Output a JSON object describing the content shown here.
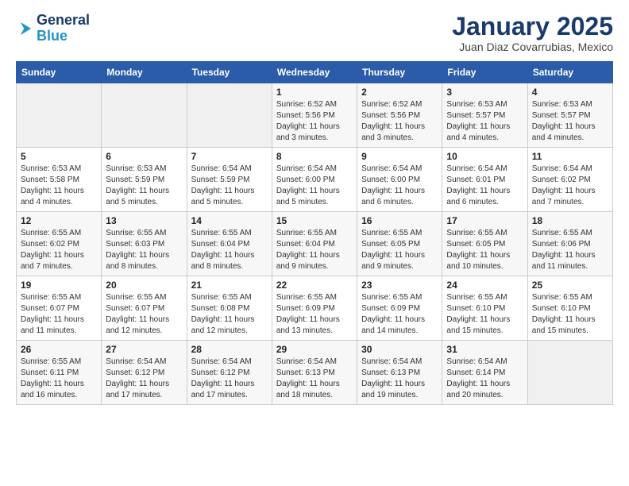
{
  "header": {
    "logo_line1": "General",
    "logo_line2": "Blue",
    "month_title": "January 2025",
    "location": "Juan Diaz Covarrubias, Mexico"
  },
  "weekdays": [
    "Sunday",
    "Monday",
    "Tuesday",
    "Wednesday",
    "Thursday",
    "Friday",
    "Saturday"
  ],
  "weeks": [
    [
      {
        "day": "",
        "info": ""
      },
      {
        "day": "",
        "info": ""
      },
      {
        "day": "",
        "info": ""
      },
      {
        "day": "1",
        "info": "Sunrise: 6:52 AM\nSunset: 5:56 PM\nDaylight: 11 hours and 3 minutes."
      },
      {
        "day": "2",
        "info": "Sunrise: 6:52 AM\nSunset: 5:56 PM\nDaylight: 11 hours and 3 minutes."
      },
      {
        "day": "3",
        "info": "Sunrise: 6:53 AM\nSunset: 5:57 PM\nDaylight: 11 hours and 4 minutes."
      },
      {
        "day": "4",
        "info": "Sunrise: 6:53 AM\nSunset: 5:57 PM\nDaylight: 11 hours and 4 minutes."
      }
    ],
    [
      {
        "day": "5",
        "info": "Sunrise: 6:53 AM\nSunset: 5:58 PM\nDaylight: 11 hours and 4 minutes."
      },
      {
        "day": "6",
        "info": "Sunrise: 6:53 AM\nSunset: 5:59 PM\nDaylight: 11 hours and 5 minutes."
      },
      {
        "day": "7",
        "info": "Sunrise: 6:54 AM\nSunset: 5:59 PM\nDaylight: 11 hours and 5 minutes."
      },
      {
        "day": "8",
        "info": "Sunrise: 6:54 AM\nSunset: 6:00 PM\nDaylight: 11 hours and 5 minutes."
      },
      {
        "day": "9",
        "info": "Sunrise: 6:54 AM\nSunset: 6:00 PM\nDaylight: 11 hours and 6 minutes."
      },
      {
        "day": "10",
        "info": "Sunrise: 6:54 AM\nSunset: 6:01 PM\nDaylight: 11 hours and 6 minutes."
      },
      {
        "day": "11",
        "info": "Sunrise: 6:54 AM\nSunset: 6:02 PM\nDaylight: 11 hours and 7 minutes."
      }
    ],
    [
      {
        "day": "12",
        "info": "Sunrise: 6:55 AM\nSunset: 6:02 PM\nDaylight: 11 hours and 7 minutes."
      },
      {
        "day": "13",
        "info": "Sunrise: 6:55 AM\nSunset: 6:03 PM\nDaylight: 11 hours and 8 minutes."
      },
      {
        "day": "14",
        "info": "Sunrise: 6:55 AM\nSunset: 6:04 PM\nDaylight: 11 hours and 8 minutes."
      },
      {
        "day": "15",
        "info": "Sunrise: 6:55 AM\nSunset: 6:04 PM\nDaylight: 11 hours and 9 minutes."
      },
      {
        "day": "16",
        "info": "Sunrise: 6:55 AM\nSunset: 6:05 PM\nDaylight: 11 hours and 9 minutes."
      },
      {
        "day": "17",
        "info": "Sunrise: 6:55 AM\nSunset: 6:05 PM\nDaylight: 11 hours and 10 minutes."
      },
      {
        "day": "18",
        "info": "Sunrise: 6:55 AM\nSunset: 6:06 PM\nDaylight: 11 hours and 11 minutes."
      }
    ],
    [
      {
        "day": "19",
        "info": "Sunrise: 6:55 AM\nSunset: 6:07 PM\nDaylight: 11 hours and 11 minutes."
      },
      {
        "day": "20",
        "info": "Sunrise: 6:55 AM\nSunset: 6:07 PM\nDaylight: 11 hours and 12 minutes."
      },
      {
        "day": "21",
        "info": "Sunrise: 6:55 AM\nSunset: 6:08 PM\nDaylight: 11 hours and 12 minutes."
      },
      {
        "day": "22",
        "info": "Sunrise: 6:55 AM\nSunset: 6:09 PM\nDaylight: 11 hours and 13 minutes."
      },
      {
        "day": "23",
        "info": "Sunrise: 6:55 AM\nSunset: 6:09 PM\nDaylight: 11 hours and 14 minutes."
      },
      {
        "day": "24",
        "info": "Sunrise: 6:55 AM\nSunset: 6:10 PM\nDaylight: 11 hours and 15 minutes."
      },
      {
        "day": "25",
        "info": "Sunrise: 6:55 AM\nSunset: 6:10 PM\nDaylight: 11 hours and 15 minutes."
      }
    ],
    [
      {
        "day": "26",
        "info": "Sunrise: 6:55 AM\nSunset: 6:11 PM\nDaylight: 11 hours and 16 minutes."
      },
      {
        "day": "27",
        "info": "Sunrise: 6:54 AM\nSunset: 6:12 PM\nDaylight: 11 hours and 17 minutes."
      },
      {
        "day": "28",
        "info": "Sunrise: 6:54 AM\nSunset: 6:12 PM\nDaylight: 11 hours and 17 minutes."
      },
      {
        "day": "29",
        "info": "Sunrise: 6:54 AM\nSunset: 6:13 PM\nDaylight: 11 hours and 18 minutes."
      },
      {
        "day": "30",
        "info": "Sunrise: 6:54 AM\nSunset: 6:13 PM\nDaylight: 11 hours and 19 minutes."
      },
      {
        "day": "31",
        "info": "Sunrise: 6:54 AM\nSunset: 6:14 PM\nDaylight: 11 hours and 20 minutes."
      },
      {
        "day": "",
        "info": ""
      }
    ]
  ]
}
